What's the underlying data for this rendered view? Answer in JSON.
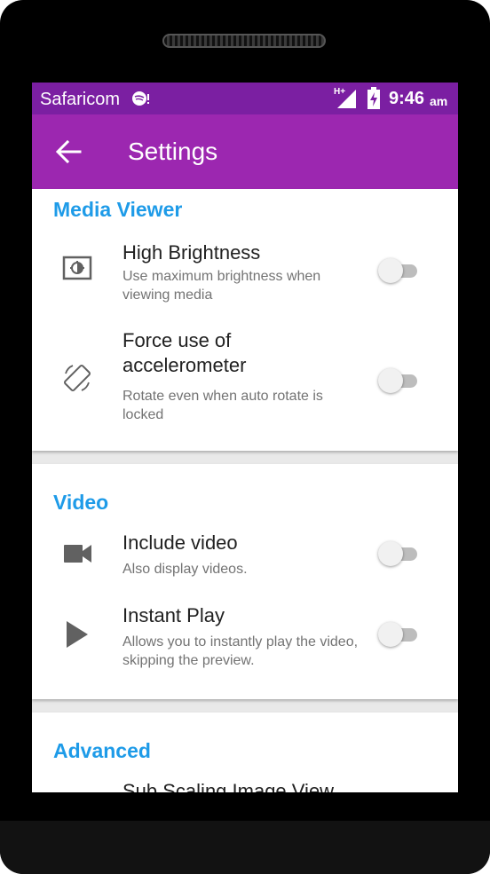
{
  "status_bar": {
    "carrier": "Safaricom",
    "network": "H+",
    "time": "9:46",
    "ampm": "am",
    "icons": [
      "spotify-icon",
      "signal-icon",
      "battery-charging-icon"
    ]
  },
  "app_bar": {
    "title": "Settings",
    "back_icon": "arrow-back-icon"
  },
  "sections": [
    {
      "title": "Media Viewer",
      "items": [
        {
          "icon": "brightness-icon",
          "title": "High Brightness",
          "subtitle": "Use maximum brightness when viewing media",
          "enabled": false
        },
        {
          "icon": "screen-rotation-icon",
          "title": "Force use of accelerometer",
          "subtitle": "Rotate even when auto rotate is locked",
          "enabled": false
        }
      ]
    },
    {
      "title": "Video",
      "items": [
        {
          "icon": "videocam-icon",
          "title": "Include video",
          "subtitle": "Also display videos.",
          "enabled": false
        },
        {
          "icon": "play-icon",
          "title": "Instant Play",
          "subtitle": "Allows you to instantly play the video, skipping the preview.",
          "enabled": false
        }
      ]
    },
    {
      "title": "Advanced",
      "items": [
        {
          "title": "Sub Scaling Image View"
        }
      ]
    }
  ],
  "colors": {
    "status_bar": "#7b1fa2",
    "app_bar": "#9c27b0",
    "accent": "#1e9be8",
    "switch_off_track": "#bdbdbd",
    "switch_off_thumb": "#f1f1f1"
  }
}
